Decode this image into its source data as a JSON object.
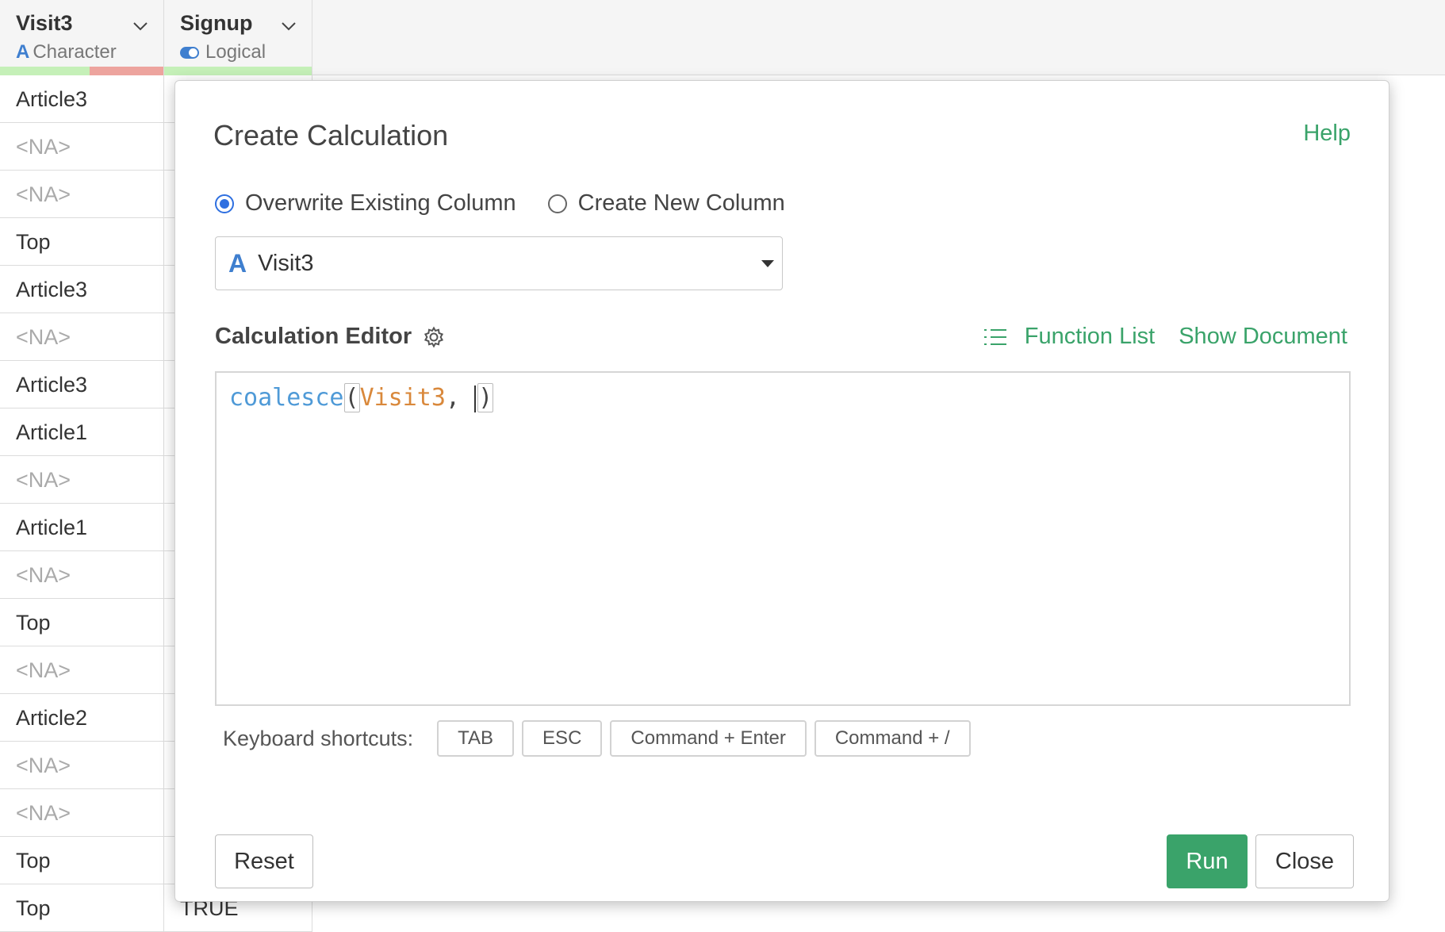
{
  "grid": {
    "columns": [
      {
        "name": "Visit3",
        "type_label": "Character",
        "type_icon": "character-type-icon"
      },
      {
        "name": "Signup",
        "type_label": "Logical",
        "type_icon": "logical-type-icon"
      }
    ],
    "visit3_values": [
      "Article3",
      "<NA>",
      "<NA>",
      "Top",
      "Article3",
      "<NA>",
      "Article3",
      "Article1",
      "<NA>",
      "Article1",
      "<NA>",
      "Top",
      "<NA>",
      "Article2",
      "<NA>",
      "<NA>",
      "Top",
      "Top"
    ],
    "signup_last_value": "TRUE"
  },
  "modal": {
    "title": "Create Calculation",
    "help_label": "Help",
    "radio_overwrite": "Overwrite Existing Column",
    "radio_create_new": "Create New Column",
    "selected_mode": "overwrite",
    "column_select": {
      "icon": "character-type-icon",
      "value": "Visit3"
    },
    "editor_label": "Calculation Editor",
    "function_list_label": "Function List",
    "show_document_label": "Show Document",
    "code": {
      "function": "coalesce",
      "open_paren": "(",
      "column": "Visit3",
      "comma": ", ",
      "close_paren": ")"
    },
    "shortcuts_label": "Keyboard shortcuts:",
    "shortcuts": [
      "TAB",
      "ESC",
      "Command + Enter",
      "Command + /"
    ],
    "reset_label": "Reset",
    "run_label": "Run",
    "close_label": "Close"
  },
  "colors": {
    "accent_green": "#3aa36a",
    "radio_blue": "#2e6fe0",
    "type_blue": "#3f7fcf",
    "quality_ok": "#c5f0b8",
    "quality_na": "#eda49e"
  }
}
